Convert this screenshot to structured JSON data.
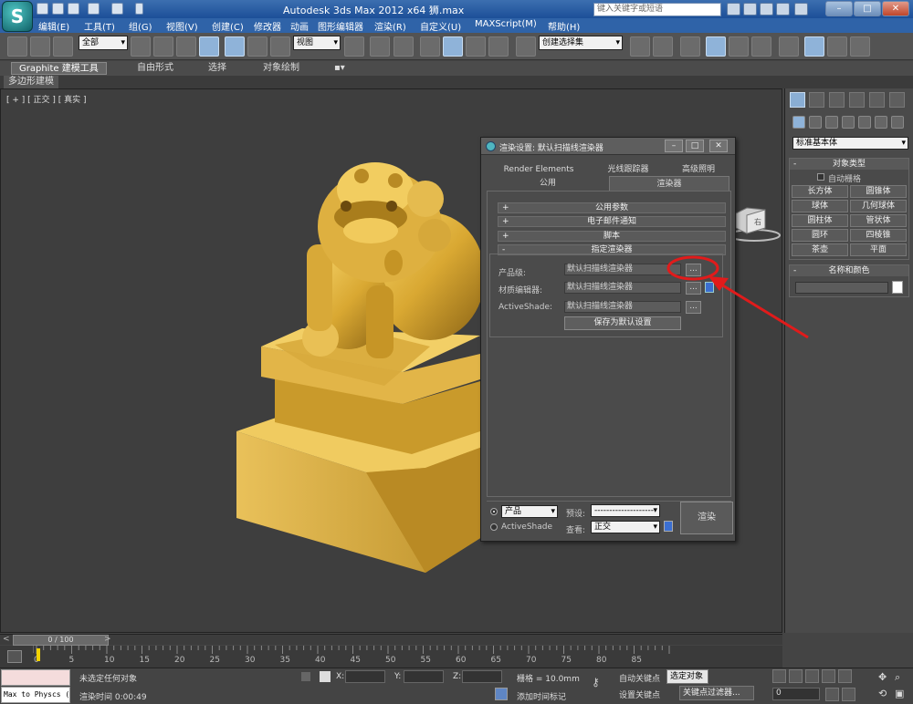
{
  "window": {
    "title": "Autodesk 3ds Max  2012 x64     狮.max",
    "search_placeholder": "键入关键字或短语"
  },
  "menu": [
    "编辑(E)",
    "工具(T)",
    "组(G)",
    "视图(V)",
    "创建(C)",
    "修改器",
    "动画",
    "图形编辑器",
    "渲染(R)",
    "自定义(U)",
    "MAXScript(M)",
    "帮助(H)"
  ],
  "toolbar": {
    "selection_filter": "全部",
    "reference_coord": "视图",
    "named_selection": "创建选择集"
  },
  "ribbon": {
    "tabs": [
      "Graphite 建模工具",
      "自由形式",
      "选择",
      "对象绘制"
    ],
    "sub_label": "多边形建模"
  },
  "viewport": {
    "label": "[ + ] [ 正交 ] [ 真实 ]",
    "viewcube_label": "右"
  },
  "render_dialog": {
    "title": "渲染设置: 默认扫描线渲染器",
    "tabs_top": [
      "Render Elements",
      "光线跟踪器",
      "高级照明"
    ],
    "tabs_bottom": [
      "公用",
      "渲染器"
    ],
    "rollouts": [
      {
        "sign": "+",
        "label": "公用参数"
      },
      {
        "sign": "+",
        "label": "电子邮件通知"
      },
      {
        "sign": "+",
        "label": "脚本"
      },
      {
        "sign": "-",
        "label": "指定渲染器"
      }
    ],
    "rows": [
      {
        "label": "产品级:",
        "value": "默认扫描线渲染器"
      },
      {
        "label": "材质编辑器:",
        "value": "默认扫描线渲染器"
      },
      {
        "label": "ActiveShade:",
        "value": "默认扫描线渲染器"
      }
    ],
    "dot_label": "...",
    "save_default": "保存为默认设置",
    "mode_product": "产品",
    "mode_activeshade": "ActiveShade",
    "preset_label": "预设:",
    "preset_value": "--------------------",
    "view_label": "查看:",
    "view_value": "正交",
    "render_button": "渲染"
  },
  "command_panel": {
    "category": "标准基本体",
    "object_type_header": "对象类型",
    "auto_grid": "自动栅格",
    "buttons": [
      "长方体",
      "圆锥体",
      "球体",
      "几何球体",
      "圆柱体",
      "管状体",
      "圆环",
      "四棱锥",
      "茶壶",
      "平面"
    ],
    "name_color_header": "名称和颜色"
  },
  "timeline": {
    "frame_readout": "0 / 100",
    "ticks": [
      "0",
      "5",
      "10",
      "15",
      "20",
      "25",
      "30",
      "35",
      "40",
      "45",
      "50",
      "55",
      "60",
      "65",
      "70",
      "75",
      "80",
      "85"
    ]
  },
  "status": {
    "maxscript_text": "Max to Physcs (",
    "selection": "未选定任何对象",
    "render_time": "渲染时间  0:00:49",
    "x_label": "X:",
    "y_label": "Y:",
    "z_label": "Z:",
    "grid": "栅格 = 10.0mm",
    "add_time_tag": "添加时间标记",
    "auto_key": "自动关键点",
    "set_key": "设置关键点",
    "selected_obj": "选定对象",
    "key_filters": "关键点过滤器...",
    "frame": "0"
  },
  "colors": {
    "annotation": "#e11b1b",
    "lion_gold": "#d9a832"
  }
}
